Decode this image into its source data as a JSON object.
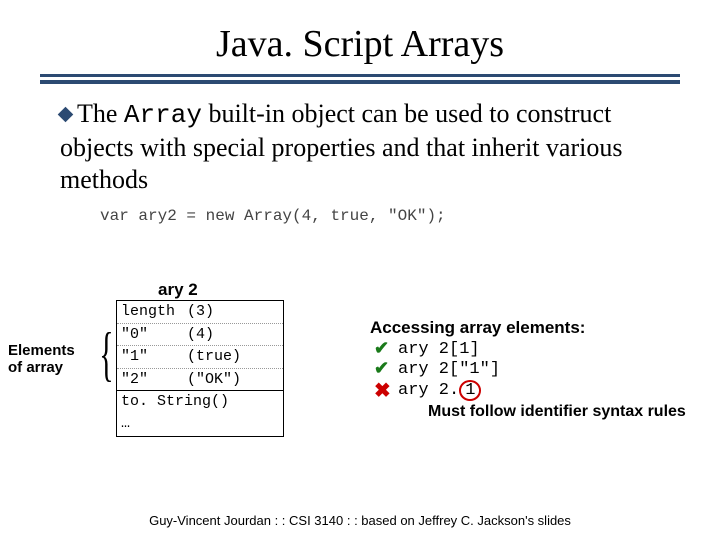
{
  "title": "Java. Script Arrays",
  "body": {
    "pre": "The ",
    "code": "Array",
    "post": " built-in object can be used to construct objects with special properties and that inherit various methods"
  },
  "code_line": "var ary2 = new Array(4, true, \"OK\");",
  "table": {
    "title": "ary 2",
    "props": [
      {
        "k": "length",
        "v": "(3)"
      },
      {
        "k": "\"0\"",
        "v": "(4)"
      },
      {
        "k": "\"1\"",
        "v": "(true)"
      },
      {
        "k": "\"2\"",
        "v": "(\"OK\")"
      }
    ],
    "methods": [
      "to. String()",
      "…"
    ]
  },
  "elements_label_l1": "Elements",
  "elements_label_l2": "of array",
  "access": {
    "title": "Accessing array elements:",
    "line1": "ary 2[1]",
    "line2": "ary 2[\"1\"]",
    "line3_pre": "ary 2.",
    "line3_one": "1",
    "note": "Must follow identifier syntax rules",
    "check": "✔",
    "cross": "✖"
  },
  "footer": "Guy-Vincent Jourdan : : CSI 3140 : : based on Jeffrey C. Jackson's slides"
}
